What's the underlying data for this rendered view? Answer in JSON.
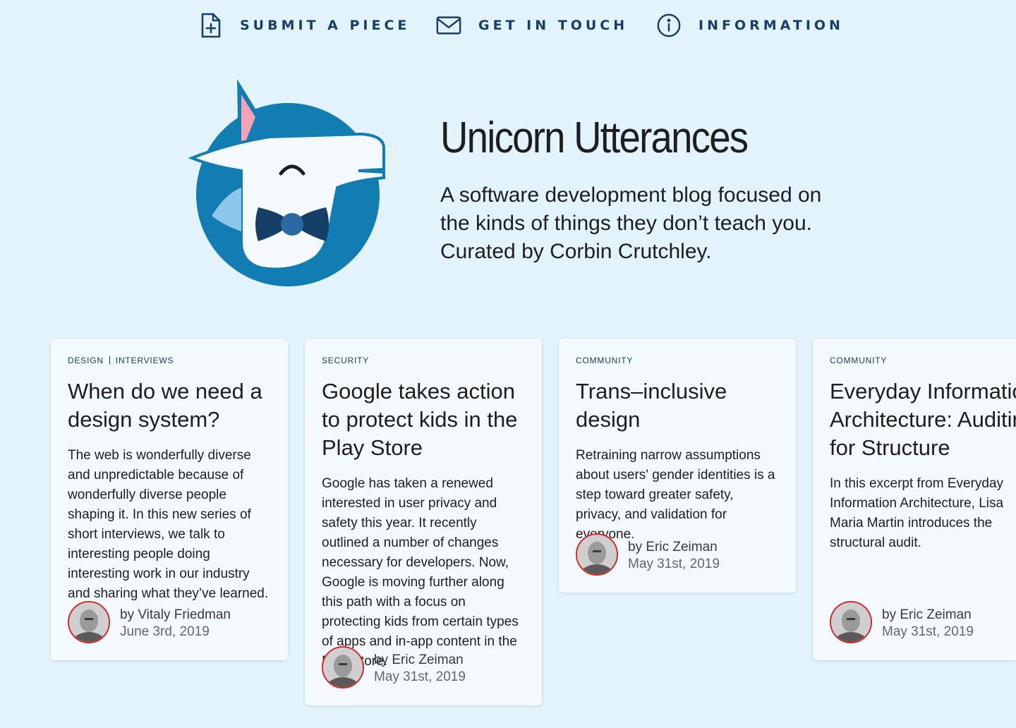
{
  "nav": [
    {
      "label": "SUBMIT A PIECE",
      "icon": "file-plus-icon"
    },
    {
      "label": "GET IN TOUCH",
      "icon": "mail-icon"
    },
    {
      "label": "INFORMATION",
      "icon": "info-icon"
    }
  ],
  "site": {
    "title": "Unicorn Utterances",
    "description": "A software development blog focused on the kinds of things they don’t teach you. Curated by Corbin Crutchley."
  },
  "posts": [
    {
      "tags": [
        "DESIGN",
        "INTERVIEWS"
      ],
      "title": "When do we need a design system?",
      "excerpt": "The web is wonderfully diverse and unpredictable because of wonderfully diverse people shaping it. In this new series of short interviews, we talk to interesting people doing interesting work in our industry and sharing what they’ve learned.",
      "author": "by Vitaly Friedman",
      "date": "June 3rd, 2019"
    },
    {
      "tags": [
        "SECURITY"
      ],
      "title": "Google takes action to protect kids in the Play Store",
      "excerpt": "Google has taken a renewed interested in user privacy and safety this year. It recently outlined a number of changes necessary for developers. Now, Google is moving further along this path with a focus on protecting kids from certain types of apps and in-app content in the Play Store.",
      "author": "by Eric Zeiman",
      "date": "May 31st, 2019"
    },
    {
      "tags": [
        "COMMUNITY"
      ],
      "title": "Trans–inclusive design",
      "excerpt": "Retraining narrow assumptions about users' gender identities is a step toward greater safety, privacy, and validation for everyone.",
      "author": "by Eric Zeiman",
      "date": "May 31st, 2019"
    },
    {
      "tags": [
        "COMMUNITY"
      ],
      "title": "Everyday Information Architecture: Auditing for Structure",
      "excerpt": "In this excerpt from Everyday Information Architecture, Lisa Maria Martin introduces the structural audit.",
      "author": "by Eric Zeiman",
      "date": "May 31st, 2019"
    }
  ],
  "colors": {
    "background": "#e2f3fc",
    "nav_text": "#153f66",
    "logo_blue": "#127db3",
    "avatar_ring": "#d7262a"
  }
}
